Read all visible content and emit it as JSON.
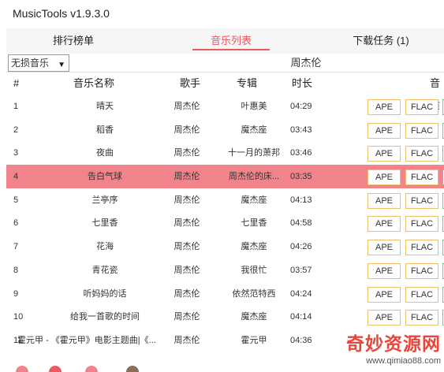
{
  "app": {
    "title": "MusicTools v1.9.3.0"
  },
  "tabs": [
    {
      "label": "排行榜单",
      "active": false
    },
    {
      "label": "音乐列表",
      "active": true
    },
    {
      "label": "下载任务 (1)",
      "active": false
    }
  ],
  "filter": {
    "quality_selected": "无损音乐",
    "artist": "周杰伦"
  },
  "columns": {
    "index": "#",
    "name": "音乐名称",
    "artist": "歌手",
    "album": "专辑",
    "duration": "时长",
    "quality": "音质"
  },
  "buttons": {
    "ape": "APE",
    "flac": "FLAC"
  },
  "songs": [
    {
      "index": "1",
      "name": "晴天",
      "artist": "周杰伦",
      "album": "叶惠美",
      "duration": "04:29"
    },
    {
      "index": "2",
      "name": "稻香",
      "artist": "周杰伦",
      "album": "魔杰座",
      "duration": "03:43"
    },
    {
      "index": "3",
      "name": "夜曲",
      "artist": "周杰伦",
      "album": "十一月的萧邦",
      "duration": "03:46"
    },
    {
      "index": "4",
      "name": "告白气球",
      "artist": "周杰伦",
      "album": "周杰伦的床...",
      "duration": "03:35",
      "selected": true
    },
    {
      "index": "5",
      "name": "兰亭序",
      "artist": "周杰伦",
      "album": "魔杰座",
      "duration": "04:13"
    },
    {
      "index": "6",
      "name": "七里香",
      "artist": "周杰伦",
      "album": "七里香",
      "duration": "04:58"
    },
    {
      "index": "7",
      "name": "花海",
      "artist": "周杰伦",
      "album": "魔杰座",
      "duration": "04:26"
    },
    {
      "index": "8",
      "name": "青花瓷",
      "artist": "周杰伦",
      "album": "我很忙",
      "duration": "03:57"
    },
    {
      "index": "9",
      "name": "听妈妈的话",
      "artist": "周杰伦",
      "album": "依然范特西",
      "duration": "04:24"
    },
    {
      "index": "10",
      "name": "给我一首歌的时间",
      "artist": "周杰伦",
      "album": "魔杰座",
      "duration": "04:14"
    },
    {
      "index": "11",
      "name": "霍元甲 - 《霍元甲》电影主题曲|《...",
      "artist": "周杰伦",
      "album": "霍元甲",
      "duration": "04:36"
    }
  ],
  "watermark": {
    "text": "奇妙资源网",
    "url": "www.qimiao88.com"
  },
  "colors": {
    "accent": "#e95b63",
    "selected_row": "#f0848a",
    "ape_border": "#f0c068",
    "more_border": "#7cc48a"
  }
}
